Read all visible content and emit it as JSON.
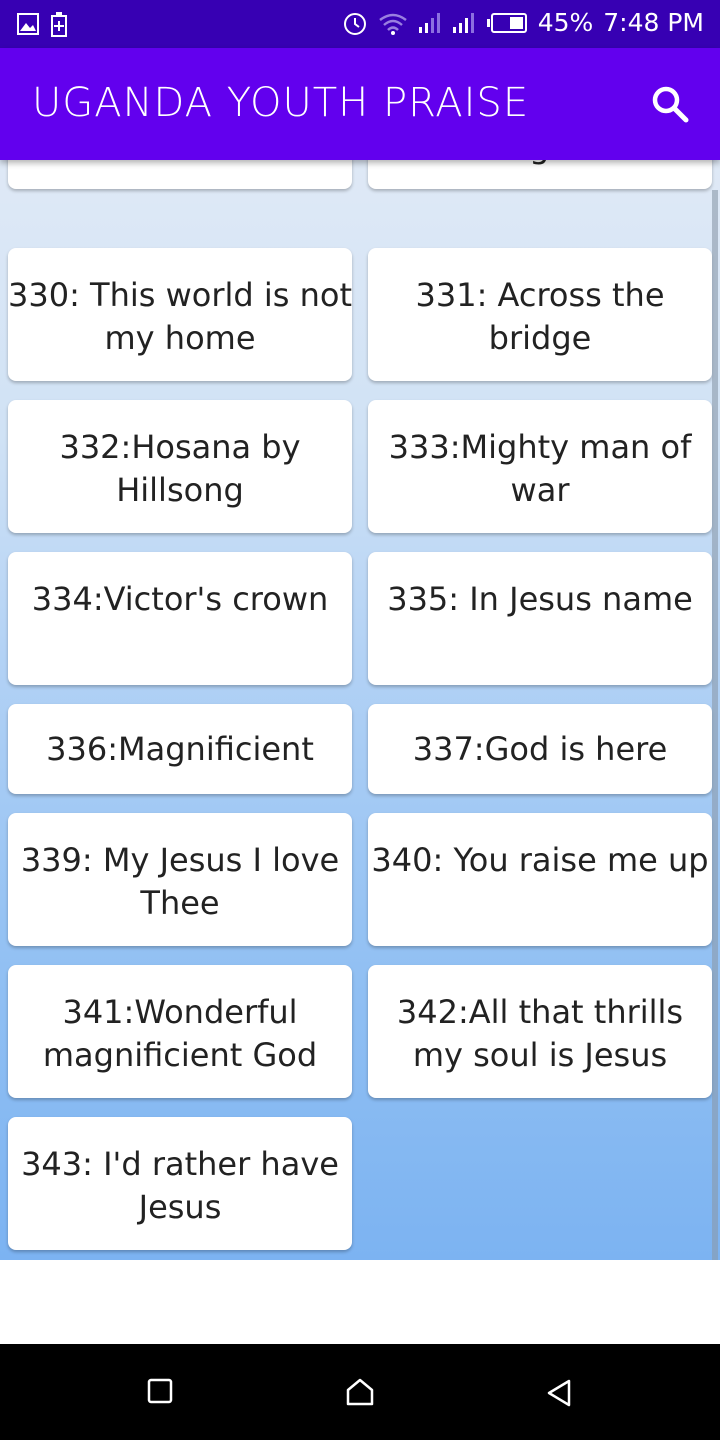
{
  "status_bar": {
    "battery": "45%",
    "time": "7:48 PM",
    "icons": [
      "image-icon",
      "battery-charging-icon",
      "alarm-icon",
      "wifi-icon",
      "signal-icon",
      "signal-icon",
      "battery-icon"
    ]
  },
  "app_bar": {
    "title": "UGANDA YOUTH PRAISE",
    "search_icon": "search-icon"
  },
  "songs": [
    {
      "label": ""
    },
    {
      "label": "high."
    },
    {
      "label": "330: This world is not my home"
    },
    {
      "label": "331: Across the bridge"
    },
    {
      "label": "332:Hosana by Hillsong"
    },
    {
      "label": "333:Mighty man of war"
    },
    {
      "label": "334:Victor's crown"
    },
    {
      "label": "335: In Jesus name"
    },
    {
      "label": "336:Magnificient"
    },
    {
      "label": "337:God is here"
    },
    {
      "label": "339: My Jesus I love Thee"
    },
    {
      "label": "340: You raise me up"
    },
    {
      "label": "341:Wonderful magnificient God"
    },
    {
      "label": "342:All that thrills my soul is Jesus"
    },
    {
      "label": "343: I'd rather have Jesus"
    }
  ],
  "nav_bar": {
    "icons": [
      "recents-icon",
      "home-icon",
      "back-icon"
    ]
  }
}
